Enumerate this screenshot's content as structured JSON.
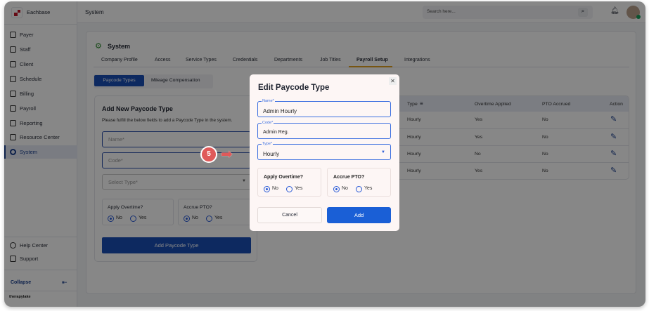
{
  "app": {
    "name": "Eachbase",
    "header_title": "System",
    "search_placeholder": "Search here...",
    "footer_brand": "therapylake"
  },
  "sidebar": {
    "items": [
      {
        "label": "Payer"
      },
      {
        "label": "Staff"
      },
      {
        "label": "Client"
      },
      {
        "label": "Schedule"
      },
      {
        "label": "Billing"
      },
      {
        "label": "Payroll"
      },
      {
        "label": "Reporting"
      },
      {
        "label": "Resource Center"
      },
      {
        "label": "System",
        "active": true
      }
    ],
    "bottom": [
      {
        "label": "Help Center"
      },
      {
        "label": "Support"
      }
    ],
    "collapse": "Collapse"
  },
  "page": {
    "title": "System",
    "tabs": [
      "Company Profile",
      "Access",
      "Service Types",
      "Credentials",
      "Departments",
      "Job Titles",
      "Payroll Setup",
      "Integrations"
    ],
    "active_tab": "Payroll Setup",
    "subtabs": [
      "Paycode Types",
      "Mileage Compensation"
    ]
  },
  "add_form": {
    "title": "Add New Paycode Type",
    "description": "Please fulfill the below fields to add a Paycode Type in the system.",
    "name_placeholder": "Name*",
    "code_placeholder": "Code*",
    "type_placeholder": "Select Type*",
    "overtime_label": "Apply Overtime?",
    "pto_label": "Accrue PTO?",
    "no": "No",
    "yes": "Yes",
    "submit": "Add Paycode Type"
  },
  "table": {
    "headers": [
      "Type",
      "Overtime Applied",
      "PTO Accrued",
      "Action"
    ],
    "rows": [
      [
        "Hourly",
        "Yes",
        "No"
      ],
      [
        "Hourly",
        "Yes",
        "No"
      ],
      [
        "Hourly",
        "No",
        "No"
      ],
      [
        "Hourly",
        "Yes",
        "No"
      ]
    ]
  },
  "modal": {
    "title": "Edit Paycode Type",
    "name_label": "Name*",
    "name_value": "Admin Hourly",
    "code_label": "Code*",
    "code_value": "Admin Reg.",
    "type_label": "Type*",
    "type_value": "Hourly",
    "overtime_label": "Apply Overtime?",
    "pto_label": "Accrue PTO?",
    "no": "No",
    "yes": "Yes",
    "cancel": "Cancel",
    "add": "Add"
  },
  "step_badge": "5",
  "colors": {
    "primary": "#1a5fd6",
    "badge": "#e05a5a"
  }
}
